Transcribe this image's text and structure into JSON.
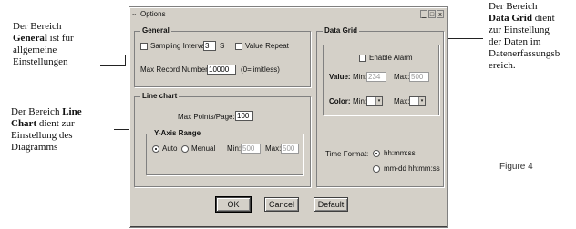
{
  "annotations": {
    "general": {
      "line1": "Der Bereich",
      "bold": "General",
      "rest1": " ist für",
      "line3": "allgemeine",
      "line4": "Einstellungen"
    },
    "linechart": {
      "line1": "Der Bereich ",
      "bold": "Line",
      "bold2": "Chart",
      "rest2": " dient zur",
      "line3": "Einstellung des",
      "line4": "Diagramms"
    },
    "datagrid": {
      "line1": "Der Bereich",
      "bold": "Data Grid",
      "rest2": " dient",
      "line3": "zur Einstellung",
      "line4": "der Daten im",
      "line5": "Datenerfassungsb",
      "line6": "ereich."
    },
    "figure_label": "Figure 4"
  },
  "dialog": {
    "title": "Options",
    "titlebar_buttons": {
      "minimize": "_",
      "maximize": "□",
      "close": "x"
    },
    "general": {
      "label": "General",
      "sampling_interval_label": "Sampling Interval",
      "sampling_interval_value": "3",
      "sampling_unit": "S",
      "value_repeat_label": "Value Repeat",
      "max_record_label": "Max Record Number",
      "max_record_value": "10000",
      "max_record_hint": "(0=limitless)"
    },
    "line_chart": {
      "label": "Line chart",
      "max_points_label": "Max Points/Page:",
      "max_points_value": "100",
      "y_axis": {
        "label": "Y-Axis Range",
        "auto_label": "Auto",
        "manual_label": "Menual",
        "min_label": "Min:",
        "min_value": "500",
        "max_label": "Max:",
        "max_value": "500"
      }
    },
    "data_grid": {
      "label": "Data Grid",
      "enable_alarm_label": "Enable Alarm",
      "value_label": "Value:",
      "value_min_label": "Min:",
      "value_min": "234",
      "value_max_label": "Max:",
      "value_max": "500",
      "color_label": "Color:",
      "color_min_label": "Min:",
      "color_max_label": "Max:",
      "time_format_label": "Time Format:",
      "time_format_opt1": "hh:mm:ss",
      "time_format_opt2": "mm-dd hh:mm:ss"
    },
    "buttons": {
      "ok": "OK",
      "cancel": "Cancel",
      "default": "Default"
    }
  }
}
